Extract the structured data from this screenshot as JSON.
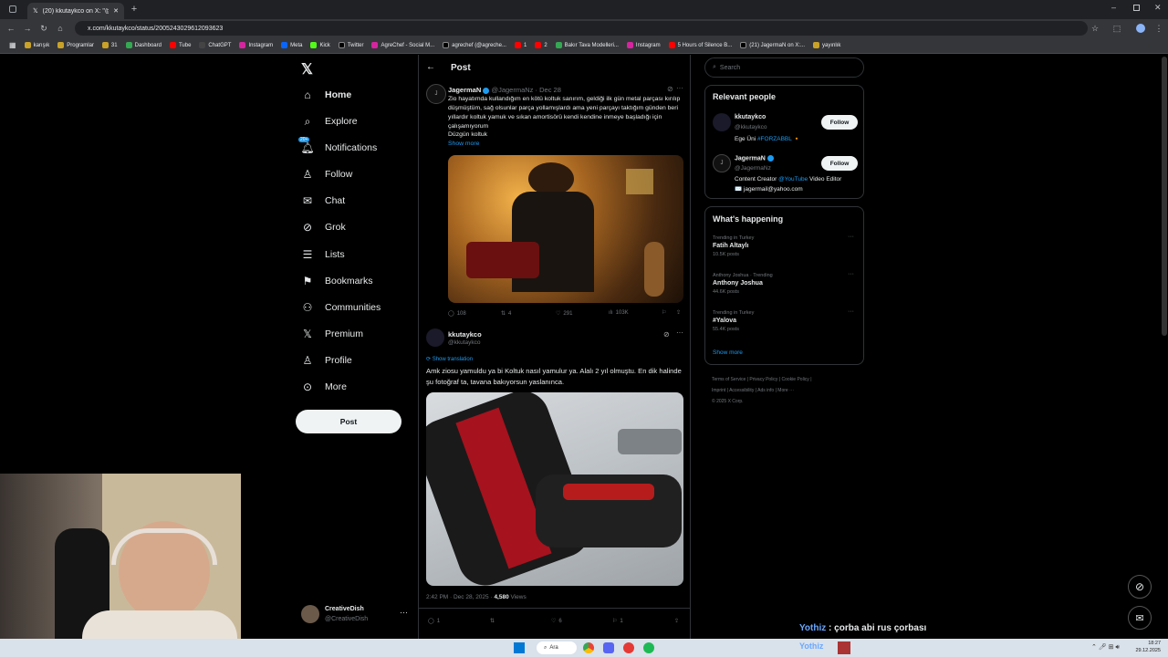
{
  "browser": {
    "tab_title": "(20) kkutaykco on X: \"@Jagerm",
    "url": "x.com/kkutaykco/status/2005243029612093623",
    "bookmarks": [
      "karışık",
      "Programlar",
      "31",
      "Dashboard",
      "Tube",
      "ChatGPT",
      "Instagram",
      "Meta",
      "Kick",
      "Twitter",
      "AgreChef - Social M...",
      "agrechef (@agreche...",
      "1",
      "2",
      "Bakır Tava Modelleri...",
      "Instagram",
      "5 Hours of Silence B...",
      "(21) JagermaN on X:...",
      "yayınlık"
    ]
  },
  "nav": {
    "items": [
      {
        "label": "Home",
        "icon": "home-icon"
      },
      {
        "label": "Explore",
        "icon": "search-icon"
      },
      {
        "label": "Notifications",
        "icon": "bell-icon",
        "badge": "20+"
      },
      {
        "label": "Follow",
        "icon": "follow-icon"
      },
      {
        "label": "Chat",
        "icon": "mail-icon"
      },
      {
        "label": "Grok",
        "icon": "grok-icon"
      },
      {
        "label": "Lists",
        "icon": "lists-icon"
      },
      {
        "label": "Bookmarks",
        "icon": "bookmark-icon"
      },
      {
        "label": "Communities",
        "icon": "communities-icon"
      },
      {
        "label": "Premium",
        "icon": "x-logo-icon"
      },
      {
        "label": "Profile",
        "icon": "profile-icon"
      },
      {
        "label": "More",
        "icon": "more-icon"
      }
    ],
    "post_button": "Post",
    "account": {
      "name": "CreativeDish",
      "handle": "@CreativeDish"
    }
  },
  "post_header": {
    "title": "Post"
  },
  "quoted": {
    "name": "JagermaN",
    "handle": "@JagermaNz",
    "date": "· Dec 28",
    "text": "Zio hayatımda kullandığım en kötü koltuk sanırım, geldiği ilk gün metal parçası kırılıp düşmüştüm, sağ olsunlar parça yollamışlardı ama yeni parçayı taktığım günden beri yıllardır koltuk yamuk ve sıkan amortisörü kendi kendine inmeye başladığı için çalışamıyorum",
    "text2": "Düzgün koltuk",
    "show_more": "Show more",
    "stats": {
      "replies": "108",
      "reposts": "4",
      "likes": "291",
      "views": "103K"
    }
  },
  "reply": {
    "name": "kkutaykco",
    "handle": "@kkutaykco",
    "translate": "Show translation",
    "text": "Amk ziosu yamuldu ya bi Koltuk nasıl yamulur ya. Alalı 2 yıl olmuştu. En dik halinde şu fotoğraf ta, tavana bakıyorsun yaslanınca.",
    "time": "2:42 PM · Dec 28, 2025 · ",
    "views": "4,580",
    "views_label": " Views",
    "stats": {
      "replies": "1",
      "likes": "6",
      "bookmarks": "1"
    }
  },
  "sidebar": {
    "search_placeholder": "Search",
    "relevant_title": "Relevant people",
    "people": [
      {
        "name": "kkutaykco",
        "handle": "@kkutaykco",
        "bio": "Ege Üni ",
        "bio_tag": "#FORZABBL",
        "bio_end": " 🔸",
        "follow": "Follow"
      },
      {
        "name": "JagermaN",
        "handle": "@JagermaNz",
        "bio": "Content Creator ",
        "bio_tag": "@YouTube",
        "bio_end": " Video Editor",
        "bio2": "✉️ jagermail@yahoo.com",
        "follow": "Follow"
      }
    ],
    "happening_title": "What's happening",
    "trends": [
      {
        "context": "Trending in Turkey",
        "name": "Fatih Altaylı",
        "posts": "10.5K posts"
      },
      {
        "context": "Anthony Joshua · Trending",
        "name": "Anthony Joshua",
        "posts": "44.6K posts"
      },
      {
        "context": "Trending in Turkey",
        "name": "#Yalova",
        "posts": "55.4K posts"
      }
    ],
    "show_more": "Show more",
    "footer": [
      "Terms of Service",
      "Privacy Policy",
      "Cookie Policy",
      "Imprint",
      "Accessibility",
      "Ads info",
      "More ···",
      "© 2025 X Corp."
    ]
  },
  "overlay": {
    "chat_user": "Yothiz",
    "chat_sep": " : ",
    "chat_text": "çorba abi rus çorbası"
  },
  "taskbar": {
    "search": "Ara",
    "time": "18:27",
    "date": "29.12.2025",
    "user": "Yothiz"
  }
}
